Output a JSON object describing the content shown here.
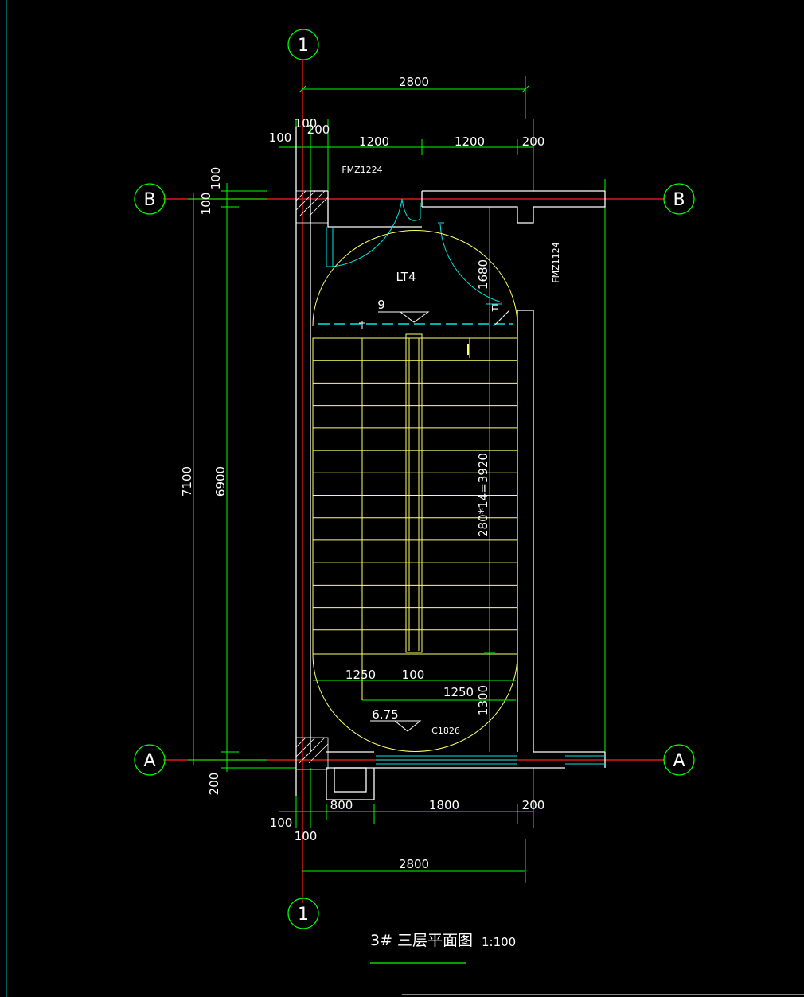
{
  "drawing": {
    "title": "3# 三层平面图",
    "scale": "1:100",
    "grid_axes": {
      "col_top": "1",
      "col_bottom": "1",
      "row_top": "B",
      "row_bottom": "A"
    },
    "top_dims": {
      "overall": "2800",
      "left_100": "100",
      "left_100b": "100",
      "left_200": "200",
      "seg1": "1200",
      "seg2": "1200",
      "right_200": "200"
    },
    "bottom_dims": {
      "overall": "2800",
      "left_100": "100",
      "left_100b": "100",
      "seg1": "800",
      "seg2": "1800",
      "right_200": "200"
    },
    "left_dims": {
      "overall": "7100",
      "inner": "6900",
      "top_100a": "100",
      "top_100b": "100",
      "bottom_200": "200"
    },
    "inner_dims": {
      "flight": "280*14=3920",
      "upper_landing": "1680",
      "lower_landing": "1300",
      "lw": "1250",
      "gap": "100",
      "rw": "1250"
    },
    "labels": {
      "door_top": "FMZ1224",
      "door_right": "FMZ1124",
      "stair": "LT4",
      "upper_level": "9",
      "lower_level": "6.75",
      "window": "C1826",
      "up_mark": "TL"
    },
    "colors": {
      "grid": "#00ff00",
      "wall": "#ffffff",
      "axis": "#ff2020",
      "stair": "#ffff66",
      "door": "#00ffff",
      "bg": "#000000"
    }
  }
}
